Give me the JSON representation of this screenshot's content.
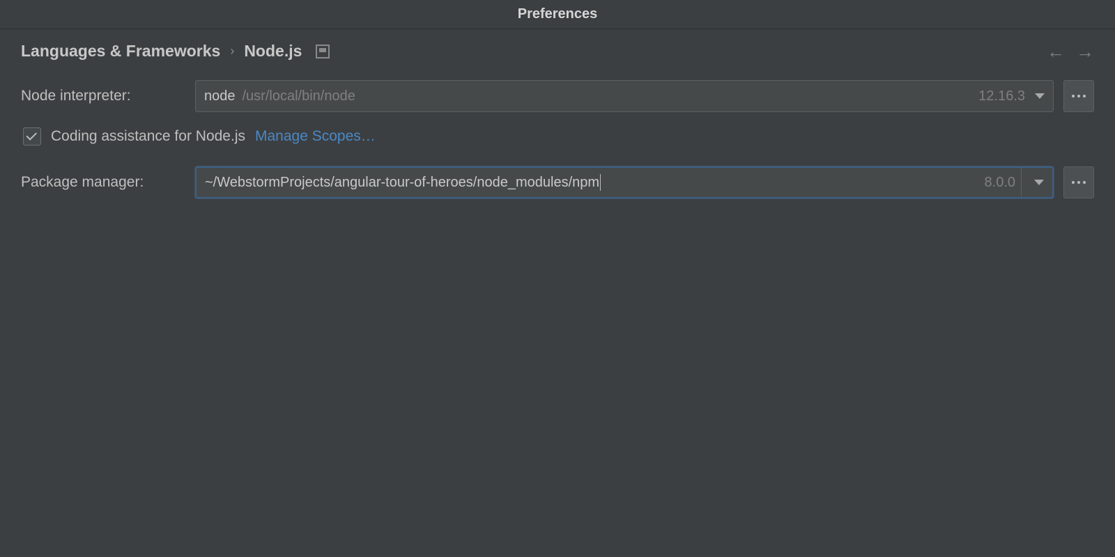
{
  "window": {
    "title": "Preferences"
  },
  "breadcrumb": {
    "root": "Languages & Frameworks",
    "leaf": "Node.js"
  },
  "interpreter": {
    "label": "Node interpreter:",
    "name": "node",
    "path": "/usr/local/bin/node",
    "version": "12.16.3"
  },
  "coding_assist": {
    "label": "Coding assistance for Node.js",
    "checked": true,
    "manage_scopes": "Manage Scopes…"
  },
  "package_manager": {
    "label": "Package manager:",
    "path": "~/WebstormProjects/angular-tour-of-heroes/node_modules/npm",
    "version": "8.0.0"
  }
}
